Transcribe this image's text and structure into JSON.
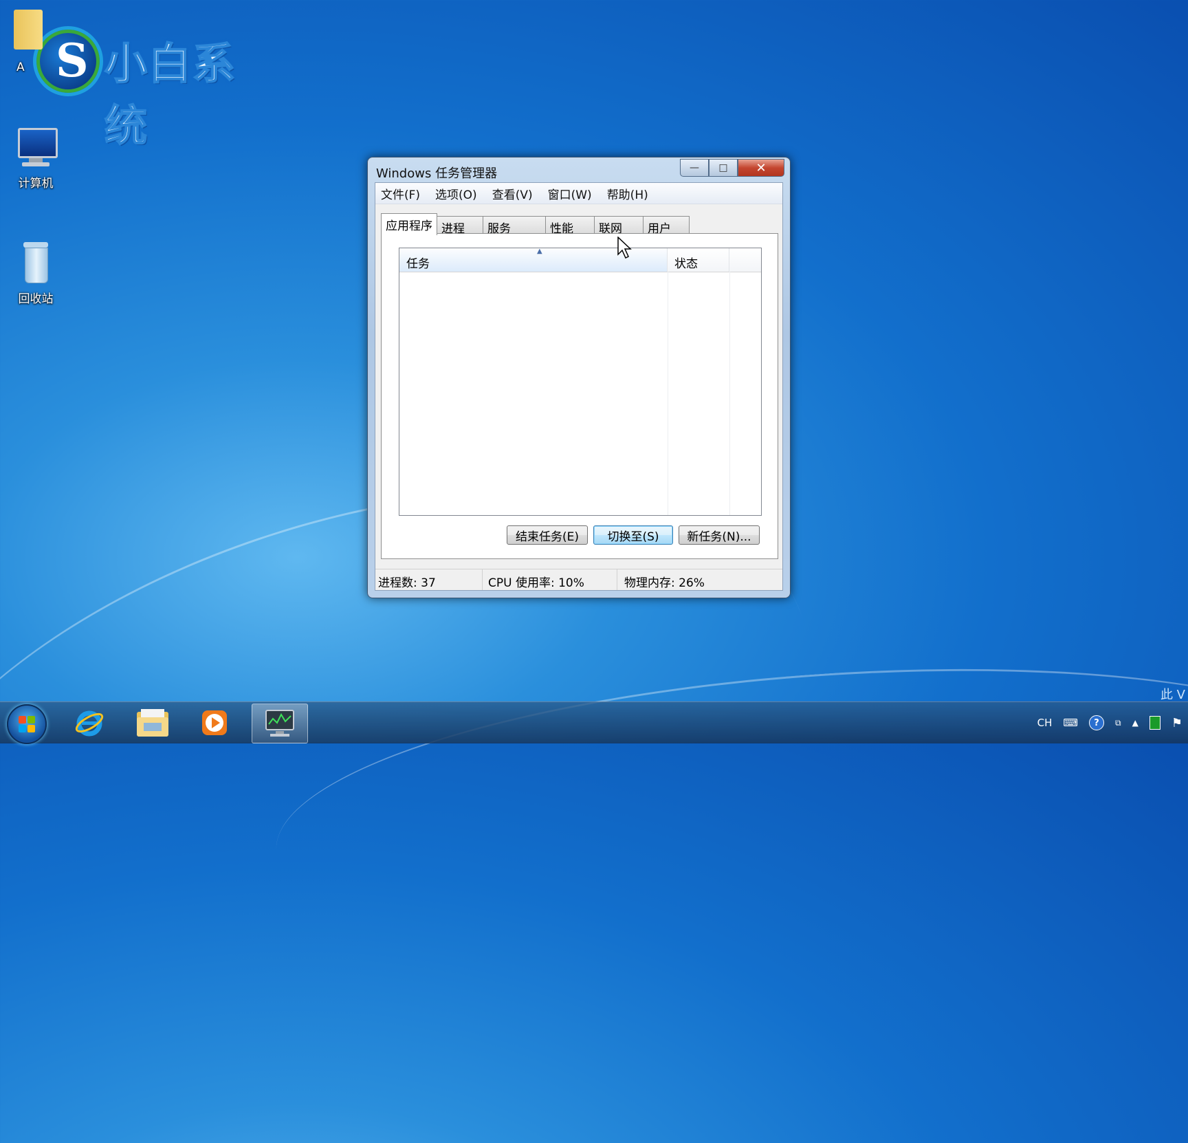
{
  "desktop": {
    "icons": [
      {
        "label": "A",
        "icon": "folder-icon"
      },
      {
        "label": "计算机",
        "icon": "computer-icon"
      },
      {
        "label": "回收站",
        "icon": "recycle-bin-icon"
      }
    ],
    "logo_text": "小白系统",
    "watermark": "此 V"
  },
  "window": {
    "title": "Windows 任务管理器",
    "controls": {
      "minimize": "—",
      "maximize": "□",
      "close": "✕"
    },
    "menu": [
      "文件(F)",
      "选项(O)",
      "查看(V)",
      "窗口(W)",
      "帮助(H)"
    ],
    "tabs": [
      "应用程序",
      "进程",
      "服务",
      "性能",
      "联网",
      "用户"
    ],
    "active_tab": "应用程序",
    "list": {
      "columns": [
        "任务",
        "状态"
      ],
      "sort_indicator": "▲",
      "rows": []
    },
    "buttons": {
      "end_task": "结束任务(E)",
      "switch_to": "切换至(S)",
      "new_task": "新任务(N)..."
    },
    "status": {
      "processes": "进程数: 37",
      "cpu": "CPU 使用率: 10%",
      "memory": "物理内存: 26%"
    }
  },
  "taskbar": {
    "items": [
      "internet-explorer-icon",
      "file-explorer-icon",
      "media-player-icon",
      "task-manager-icon"
    ],
    "tray": {
      "language": "CH",
      "keyboard_icon": "keyboard-icon",
      "help_icon": "help-icon",
      "show_hidden_icon": "chevron-up-icon",
      "network_icon": "network-icon",
      "action_center_icon": "action-center-flag-icon"
    }
  },
  "colors": {
    "desktop": "#126fcc",
    "window_frame": "#aec7e4",
    "close_button": "#c44630",
    "selected_header": "#dcebfb"
  }
}
